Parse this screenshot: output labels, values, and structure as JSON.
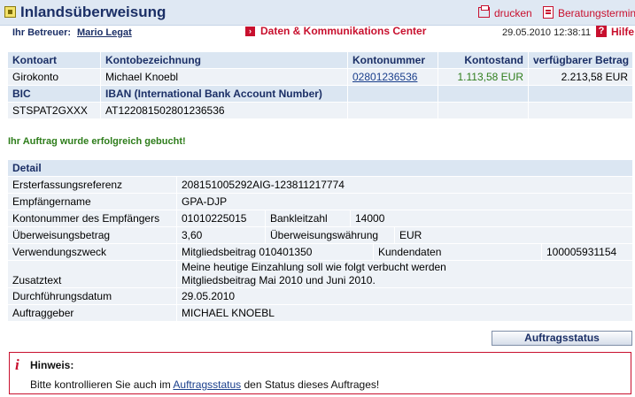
{
  "header": {
    "title": "Inlandsüberweisung",
    "print_label": "drucken",
    "appointment_label": "Beratungstermin",
    "advisor_label": "Ihr Betreuer:",
    "advisor_name": "Mario Legat",
    "dkc_label": "Daten & Kommunikations Center",
    "timestamp": "29.05.2010 12:38:11",
    "help_label": "Hilfe"
  },
  "account": {
    "headers": [
      "Kontoart",
      "Kontobezeichnung",
      "Kontonummer",
      "Kontostand",
      "verfügbarer Betrag"
    ],
    "row": {
      "type": "Girokonto",
      "name": "Michael Knoebl",
      "number": "02801236536",
      "balance": "1.113,58 EUR",
      "available": "2.213,58 EUR"
    },
    "bic_header": "BIC",
    "iban_header": "IBAN (International Bank Account Number)",
    "bic": "STSPAT2GXXX",
    "iban": "AT122081502801236536"
  },
  "success_message": "Ihr Auftrag wurde erfolgreich gebucht!",
  "detail": {
    "header": "Detail",
    "first_ref_label": "Ersterfassungsreferenz",
    "first_ref_value": "208151005292AIG-123811217774",
    "recipient_label": "Empfängername",
    "recipient_value": "GPA-DJP",
    "recipient_account_label": "Kontonummer des Empfängers",
    "recipient_account_value": "01010225015",
    "bank_code_label": "Bankleitzahl",
    "bank_code_value": "14000",
    "amount_label": "Überweisungsbetrag",
    "amount_value": "3,60",
    "currency_label": "Überweisungswährung",
    "currency_value": "EUR",
    "purpose_label": "Verwendungszweck",
    "purpose_value": "Mitgliedsbeitrag 010401350",
    "customer_data_label": "Kundendaten",
    "customer_data_value": "100005931154",
    "extra_text_label": "Zusatztext",
    "extra_text_line1": "Meine heutige Einzahlung soll wie folgt verbucht werden",
    "extra_text_line2": "Mitgliedsbeitrag Mai 2010 und Juni 2010.",
    "execution_date_label": "Durchführungsdatum",
    "execution_date_value": "29.05.2010",
    "ordering_party_label": "Auftraggeber",
    "ordering_party_value": "MICHAEL KNOEBL"
  },
  "status_button_label": "Auftragsstatus",
  "notice": {
    "title": "Hinweis:",
    "text_before": "Bitte kontrollieren Sie auch im ",
    "link": "Auftragsstatus",
    "text_after": " den Status dieses Auftrages!"
  },
  "colors": {
    "accent_red": "#c8102e",
    "header_blue": "#1b2f66",
    "success_green": "#2e7d1b",
    "balance_green": "#2e7d1b"
  }
}
